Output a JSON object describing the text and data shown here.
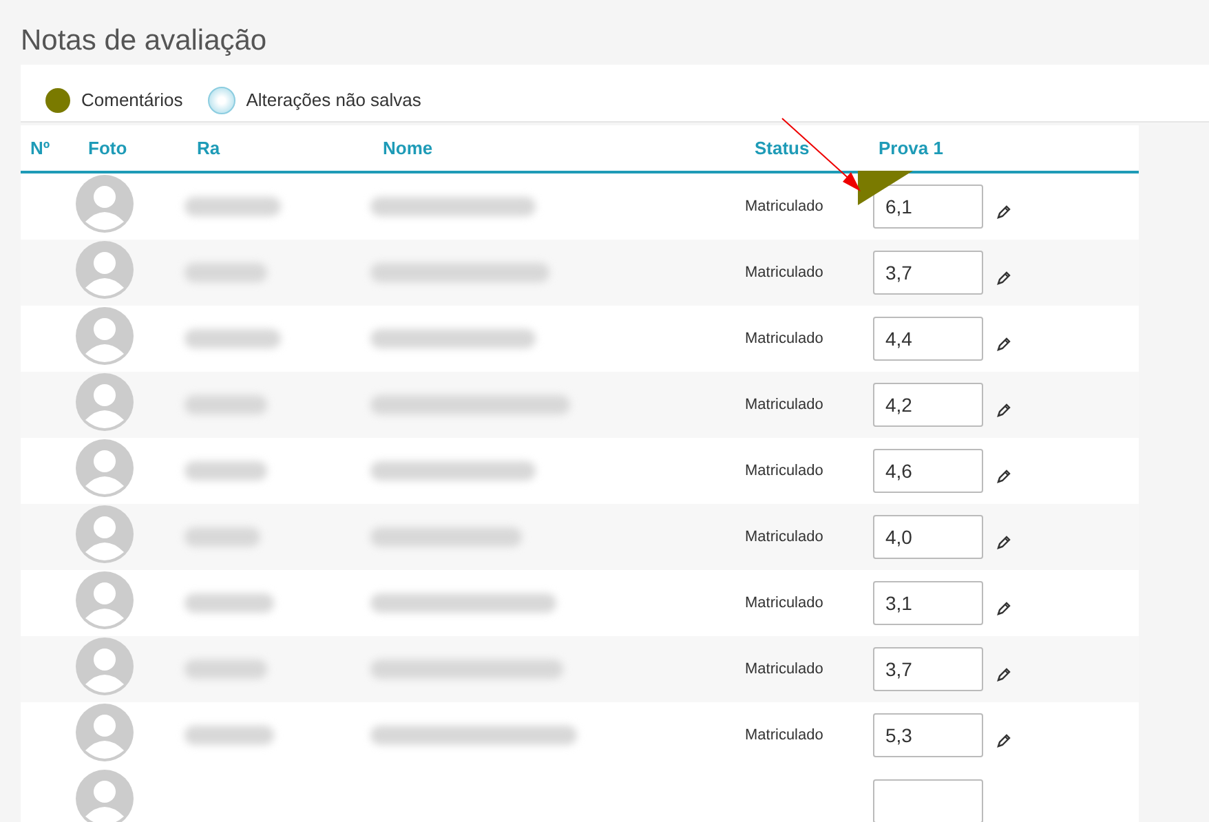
{
  "page_title": "Notas de avaliação",
  "legend": [
    {
      "label": "Comentários",
      "kind": "comment"
    },
    {
      "label": "Alterações não salvas",
      "kind": "unsaved"
    }
  ],
  "table": {
    "columns": [
      "Nº",
      "Foto",
      "Ra",
      "Nome",
      "Status",
      "Prova 1"
    ],
    "rows": [
      {
        "status": "Matriculado",
        "grade": "6,1",
        "has_comment": true
      },
      {
        "status": "Matriculado",
        "grade": "3,7",
        "has_comment": false
      },
      {
        "status": "Matriculado",
        "grade": "4,4",
        "has_comment": false
      },
      {
        "status": "Matriculado",
        "grade": "4,2",
        "has_comment": false
      },
      {
        "status": "Matriculado",
        "grade": "4,6",
        "has_comment": false
      },
      {
        "status": "Matriculado",
        "grade": "4,0",
        "has_comment": false
      },
      {
        "status": "Matriculado",
        "grade": "3,1",
        "has_comment": false
      },
      {
        "status": "Matriculado",
        "grade": "3,7",
        "has_comment": false
      },
      {
        "status": "Matriculado",
        "grade": "5,3",
        "has_comment": false
      }
    ]
  }
}
